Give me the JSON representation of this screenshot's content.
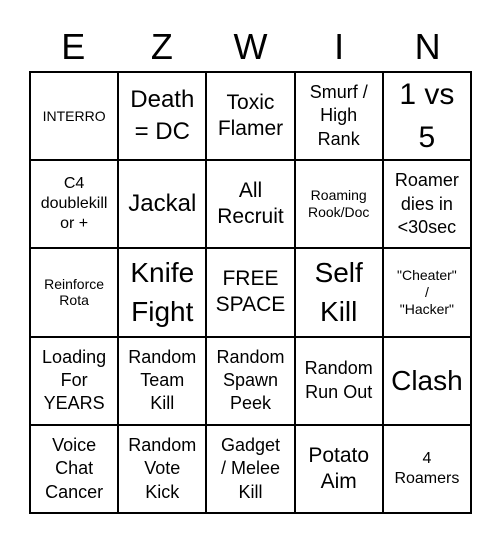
{
  "header": {
    "letters": [
      "E",
      "Z",
      "W",
      "I",
      "N"
    ]
  },
  "board": {
    "cells": [
      [
        "INTERRO",
        "Death\n= DC",
        "Toxic\nFlamer",
        "Smurf /\nHigh\nRank",
        "1 vs\n5"
      ],
      [
        "C4\ndoublekill\nor +",
        "Jackal",
        "All\nRecruit",
        "Roaming\nRook/Doc",
        "Roamer\ndies in\n<30sec"
      ],
      [
        "Reinforce\nRota",
        "Knife\nFight",
        "FREE\nSPACE",
        "Self\nKill",
        "\"Cheater\"\n/\n\"Hacker\""
      ],
      [
        "Loading\nFor\nYEARS",
        "Random\nTeam\nKill",
        "Random\nSpawn\nPeek",
        "Random\nRun Out",
        "Clash"
      ],
      [
        "Voice\nChat\nCancer",
        "Random\nVote\nKick",
        "Gadget\n/ Melee\nKill",
        "Potato\nAim",
        "4\nRoamers"
      ]
    ]
  }
}
